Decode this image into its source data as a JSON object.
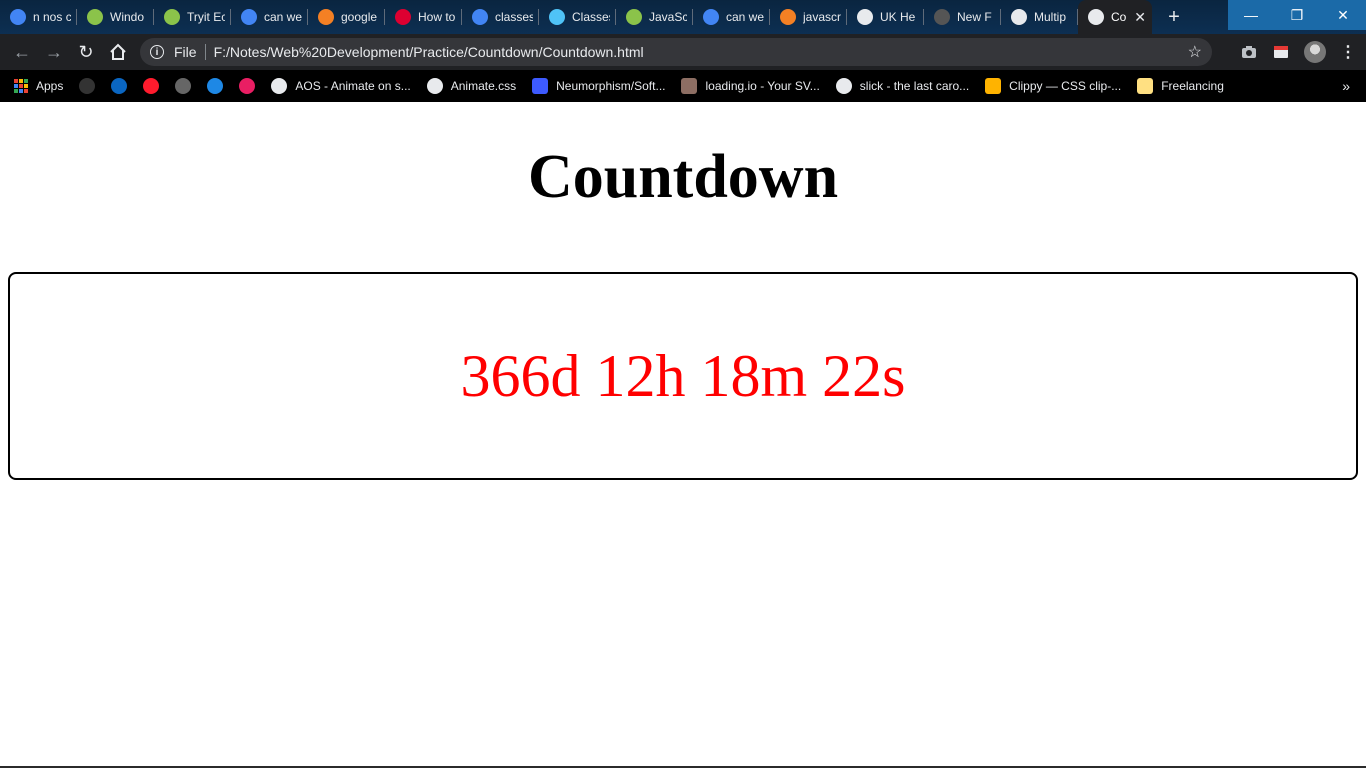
{
  "browser": {
    "tabs": [
      {
        "title": "n nos c",
        "favicon": "google-icon",
        "color": "#4285f4"
      },
      {
        "title": "Windo",
        "favicon": "w3schools-icon",
        "color": "#8bc34a"
      },
      {
        "title": "Tryit Ec",
        "favicon": "w3schools-icon",
        "color": "#8bc34a"
      },
      {
        "title": "can we",
        "favicon": "google-icon",
        "color": "#4285f4"
      },
      {
        "title": "google",
        "favicon": "stackoverflow-icon",
        "color": "#f48024"
      },
      {
        "title": "How to",
        "favicon": "angular-icon",
        "color": "#dd0031"
      },
      {
        "title": "classes",
        "favicon": "google-icon",
        "color": "#4285f4"
      },
      {
        "title": "Classes",
        "favicon": "bird-icon",
        "color": "#4fc3f7"
      },
      {
        "title": "JavaSc",
        "favicon": "w3schools-icon",
        "color": "#8bc34a"
      },
      {
        "title": "can we",
        "favicon": "google-icon",
        "color": "#4285f4"
      },
      {
        "title": "javascr",
        "favicon": "stackoverflow-icon",
        "color": "#f48024"
      },
      {
        "title": "UK He",
        "favicon": "globe-icon",
        "color": "#e8eaed"
      },
      {
        "title": "New F",
        "favicon": "github-icon",
        "color": "#555555"
      },
      {
        "title": "Multip",
        "favicon": "globe-icon",
        "color": "#e8eaed"
      }
    ],
    "active_tab": {
      "title": "Co",
      "favicon": "globe-icon",
      "close": "✕"
    },
    "new_tab": "+",
    "window_controls": {
      "minimize": "—",
      "maximize": "❐",
      "close": "✕"
    },
    "omnibox": {
      "scheme": "File",
      "url": "F:/Notes/Web%20Development/Practice/Countdown/Countdown.html"
    },
    "bookmarks_bar": {
      "apps_label": "Apps",
      "icon_only": [
        {
          "name": "github-icon",
          "color": "#333333"
        },
        {
          "name": "linkedin-icon",
          "color": "#0a66c2"
        },
        {
          "name": "opera-icon",
          "color": "#ff1b2d"
        },
        {
          "name": "sphere-icon",
          "color": "#666666"
        },
        {
          "name": "flag-icon",
          "color": "#1e88e5"
        },
        {
          "name": "js-icon",
          "color": "#e91e63"
        }
      ],
      "items": [
        {
          "label": "AOS - Animate on s...",
          "icon": "globe-icon",
          "color": "#e8eaed"
        },
        {
          "label": "Animate.css",
          "icon": "globe-icon",
          "color": "#e8eaed"
        },
        {
          "label": "Neumorphism/Soft...",
          "icon": "neumorphism-icon",
          "color": "#3d5afe"
        },
        {
          "label": "loading.io - Your SV...",
          "icon": "loadingio-icon",
          "color": "#8d6e63"
        },
        {
          "label": "slick - the last caro...",
          "icon": "globe-icon",
          "color": "#e8eaed"
        },
        {
          "label": "Clippy — CSS clip-...",
          "icon": "clippy-icon",
          "color": "#ffb300"
        },
        {
          "label": "Freelancing",
          "icon": "folder-icon",
          "color": "#ffe082"
        }
      ],
      "more": "»"
    }
  },
  "page": {
    "heading": "Countdown",
    "countdown": "366d 12h 18m 22s",
    "countdown_color": "#ff0000"
  }
}
